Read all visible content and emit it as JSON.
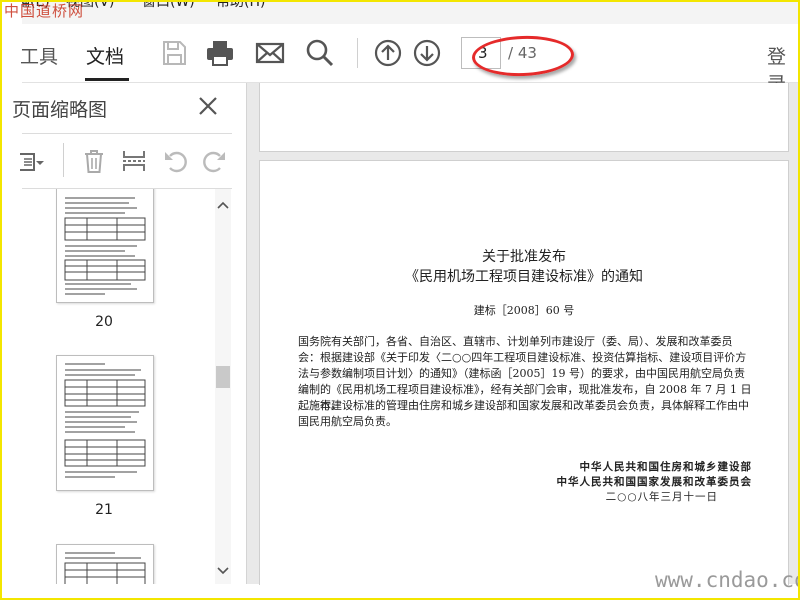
{
  "watermarks": {
    "top_left": "中国道桥网",
    "bottom_right": "www.cndao.com"
  },
  "menu": {
    "items": [
      "编(E)",
      "视图(V)",
      "窗口(W)",
      "帮助(H)"
    ]
  },
  "toolbar": {
    "tab_tools": "工具",
    "tab_document": "文档",
    "icons": [
      "save-icon",
      "print-icon",
      "mail-icon",
      "search-icon",
      "page-up-icon",
      "page-down-icon"
    ],
    "page_current": "3",
    "page_total": "/ 43",
    "login": "登录"
  },
  "sidebar": {
    "title": "页面缩略图",
    "icons": [
      "options-menu-icon",
      "delete-icon",
      "extract-icon",
      "rotate-left-icon",
      "rotate-right-icon"
    ],
    "thumbnails": [
      {
        "label": "20"
      },
      {
        "label": "21"
      },
      {
        "label": ""
      }
    ]
  },
  "document": {
    "title_line1": "关于批准发布",
    "title_line2": "《民用机场工程项目建设标准》的通知",
    "doc_number": "建标［2008］60 号",
    "para1": "国务院有关部门，各省、自治区、直辖市、计划单列市建设厅（委、局）、发展和改革委员会：",
    "para2": "根据建设部《关于印发〈二○○四年工程项目建设标准、投资估算指标、建设项目评价方法与参数编制项目计划〉的通知》（建标函［2005］19 号）的要求，由中国民用航空局负责编制的《民用机场工程项目建设标准》，经有关部门会审，现批准发布，自 2008 年 7 月 1 日起施行。",
    "para3": "本建设标准的管理由住房和城乡建设部和国家发展和改革委员会负责，具体解释工作由中国民用航空局负责。",
    "signer1": "中华人民共和国住房和城乡建设部",
    "signer2": "中华人民共和国国家发展和改革委员会",
    "date": "二○○八年三月十一日"
  },
  "colors": {
    "highlight": "#e52a2a",
    "frame": "#f3e600",
    "watermark": "#c8321e"
  }
}
